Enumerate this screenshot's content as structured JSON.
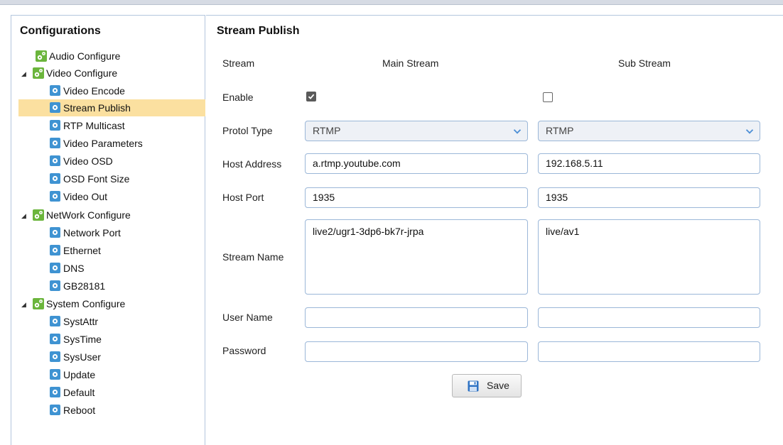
{
  "sidebar": {
    "title": "Configurations",
    "items": [
      {
        "label": "Audio Configure",
        "kind": "group",
        "icon": "config-gear-icon"
      },
      {
        "label": "Video Configure",
        "kind": "group",
        "icon": "config-gear-icon",
        "expanded": true
      },
      {
        "label": "Video Encode",
        "kind": "leaf",
        "icon": "settings-icon"
      },
      {
        "label": "Stream Publish",
        "kind": "leaf",
        "icon": "settings-icon",
        "selected": true
      },
      {
        "label": "RTP Multicast",
        "kind": "leaf",
        "icon": "settings-icon"
      },
      {
        "label": "Video Parameters",
        "kind": "leaf",
        "icon": "settings-icon"
      },
      {
        "label": "Video OSD",
        "kind": "leaf",
        "icon": "settings-icon"
      },
      {
        "label": "OSD Font Size",
        "kind": "leaf",
        "icon": "settings-icon"
      },
      {
        "label": "Video Out",
        "kind": "leaf",
        "icon": "settings-icon"
      },
      {
        "label": "NetWork Configure",
        "kind": "group",
        "icon": "config-gear-icon",
        "expanded": true
      },
      {
        "label": "Network Port",
        "kind": "leaf",
        "icon": "settings-icon"
      },
      {
        "label": "Ethernet",
        "kind": "leaf",
        "icon": "settings-icon"
      },
      {
        "label": "DNS",
        "kind": "leaf",
        "icon": "settings-icon"
      },
      {
        "label": "GB28181",
        "kind": "leaf",
        "icon": "settings-icon"
      },
      {
        "label": "System Configure",
        "kind": "group",
        "icon": "config-gear-icon",
        "expanded": true
      },
      {
        "label": "SystAttr",
        "kind": "leaf",
        "icon": "settings-icon"
      },
      {
        "label": "SysTime",
        "kind": "leaf",
        "icon": "settings-icon"
      },
      {
        "label": "SysUser",
        "kind": "leaf",
        "icon": "settings-icon"
      },
      {
        "label": "Update",
        "kind": "leaf",
        "icon": "settings-icon"
      },
      {
        "label": "Default",
        "kind": "leaf",
        "icon": "settings-icon"
      },
      {
        "label": "Reboot",
        "kind": "leaf",
        "icon": "settings-icon"
      }
    ],
    "expand_glyph": "◢"
  },
  "main": {
    "title": "Stream Publish",
    "labels": {
      "stream": "Stream",
      "enable": "Enable",
      "protocol": "Protol Type",
      "host_address": "Host Address",
      "host_port": "Host Port",
      "stream_name": "Stream Name",
      "user_name": "User Name",
      "password": "Password"
    },
    "main_stream": {
      "heading": "Main Stream",
      "enabled": true,
      "protocol": "RTMP",
      "host_address": "a.rtmp.youtube.com",
      "host_port": "1935",
      "stream_name": "live2/ugr1-3dp6-bk7r-jrpa",
      "user_name": "",
      "password": ""
    },
    "sub_stream": {
      "heading": "Sub Stream",
      "enabled": false,
      "protocol": "RTMP",
      "host_address": "192.168.5.11",
      "host_port": "1935",
      "stream_name": "live/av1",
      "user_name": "",
      "password": ""
    },
    "save_label": "Save"
  },
  "colors": {
    "selected_bg": "#fbe0a0",
    "border": "#9bb7d8",
    "icon_blue": "#3f93d2",
    "icon_green": "#6bb53c"
  }
}
